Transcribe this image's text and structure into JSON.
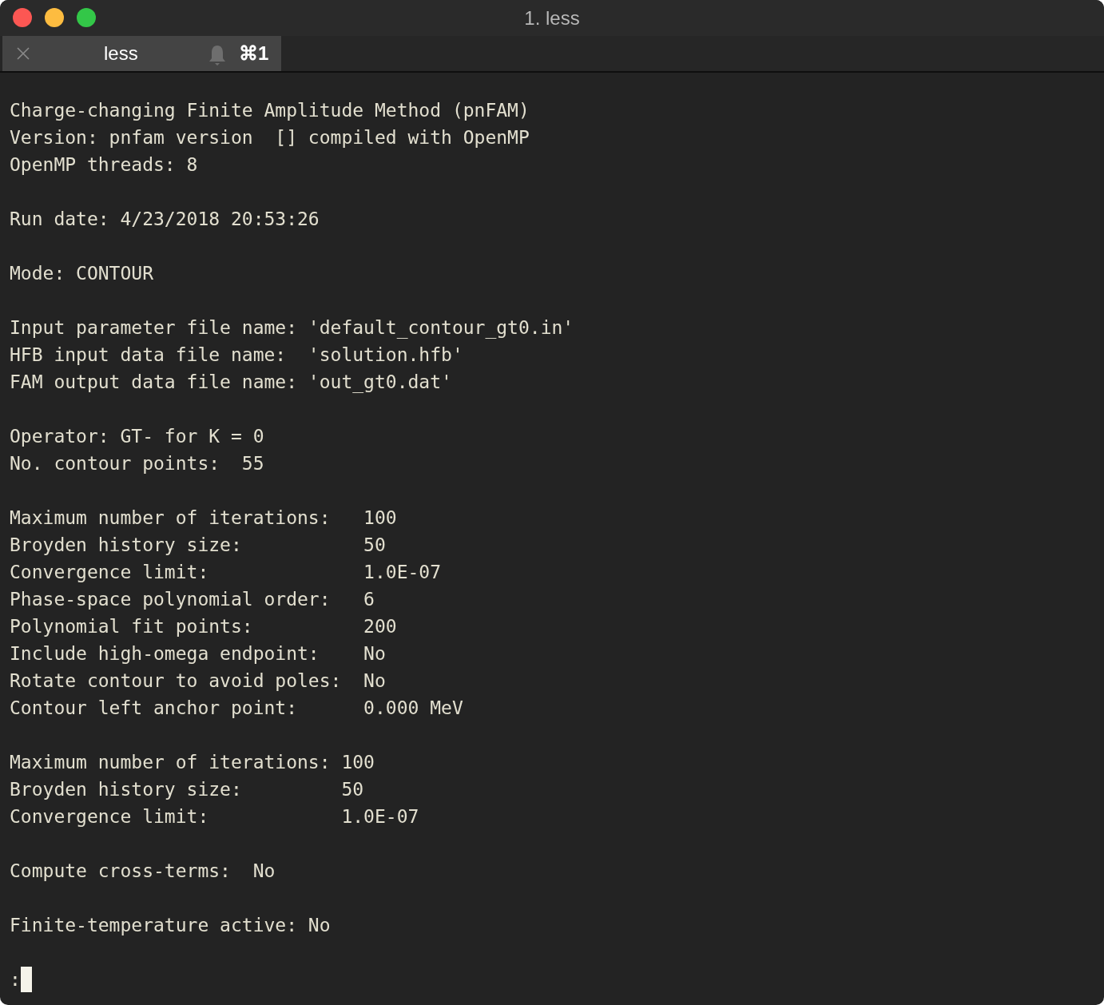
{
  "window": {
    "title": "1. less"
  },
  "tabs": [
    {
      "label": "less",
      "shortcut": "⌘1",
      "selected": true
    }
  ],
  "terminal": {
    "blocks": [
      [
        "Charge-changing Finite Amplitude Method (pnFAM)",
        "Version: pnfam version  [] compiled with OpenMP",
        "OpenMP threads: 8"
      ],
      [
        "Run date: 4/23/2018 20:53:26"
      ],
      [
        "Mode: CONTOUR"
      ],
      [
        "Input parameter file name: 'default_contour_gt0.in'",
        "HFB input data file name:  'solution.hfb'",
        "FAM output data file name: 'out_gt0.dat'"
      ],
      [
        "Operator: GT- for K = 0",
        "No. contour points:  55"
      ],
      [
        "Maximum number of iterations:   100",
        "Broyden history size:           50",
        "Convergence limit:              1.0E-07",
        "Phase-space polynomial order:   6",
        "Polynomial fit points:          200",
        "Include high-omega endpoint:    No",
        "Rotate contour to avoid poles:  No",
        "Contour left anchor point:      0.000 MeV"
      ],
      [
        "Maximum number of iterations: 100",
        "Broyden history size:         50",
        "Convergence limit:            1.0E-07"
      ],
      [
        "Compute cross-terms:  No"
      ],
      [
        "Finite-temperature active: No"
      ]
    ],
    "prompt": ":"
  }
}
